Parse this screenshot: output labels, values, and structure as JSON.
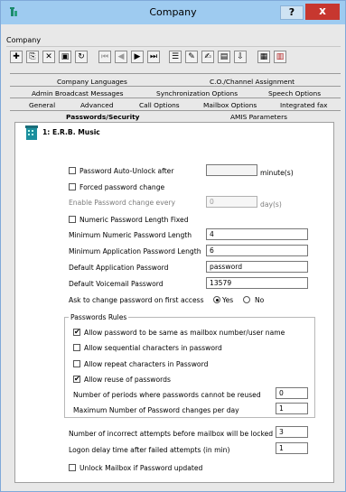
{
  "window": {
    "title": "Company",
    "help_label": "?",
    "close_label": "x"
  },
  "menu": {
    "items": [
      "Company"
    ]
  },
  "toolbar": {
    "icons": [
      "new-icon",
      "copy-icon",
      "delete-icon",
      "save-icon",
      "refresh-icon",
      "first-icon",
      "prev-icon",
      "next-icon",
      "last-icon",
      "list-icon",
      "edit-icon",
      "notes-icon",
      "report-icon",
      "import-icon",
      "report2-icon",
      "calendar-icon"
    ]
  },
  "tabs": {
    "row1": [
      "Company Languages",
      "C.O./Channel Assignment"
    ],
    "row2": [
      "Admin Broadcast Messages",
      "Synchronization Options",
      "Speech Options"
    ],
    "row3": [
      "General",
      "Advanced",
      "Call Options",
      "Mailbox Options",
      "Integrated fax"
    ],
    "row4": [
      "Passwords/Security",
      "AMIS Parameters"
    ]
  },
  "company": {
    "name": "1: E.R.B. Music"
  },
  "form": {
    "auto_unlock_label": "Password Auto-Unlock after",
    "auto_unlock_value": "",
    "auto_unlock_unit": "minute(s)",
    "forced_change_label": "Forced password change",
    "enable_change_label": "Enable Password change every",
    "enable_change_value": "0",
    "enable_change_unit": "day(s)",
    "numeric_fixed_label": "Numeric Password Length Fixed",
    "min_numeric_label": "Minimum Numeric Password Length",
    "min_numeric_value": "4",
    "min_app_label": "Minimum Application Password Length",
    "min_app_value": "6",
    "default_app_label": "Default Application Password",
    "default_app_value": "password",
    "default_vm_label": "Default Voicemail Password",
    "default_vm_value": "13579",
    "ask_change_label": "Ask to change password on first access",
    "yes_label": "Yes",
    "no_label": "No",
    "ask_change_selected": "Yes"
  },
  "rules": {
    "legend": "Passwords Rules",
    "same_as_mailbox_label": "Allow password to be same as mailbox number/user name",
    "same_as_mailbox_checked": true,
    "sequential_label": "Allow sequential characters in password",
    "sequential_checked": false,
    "repeat_label": "Allow repeat characters in Password",
    "repeat_checked": false,
    "reuse_label": "Allow reuse of passwords",
    "reuse_checked": true,
    "periods_label": "Number of periods where passwords cannot be reused",
    "periods_value": "0",
    "max_changes_label": "Maximum Number of Password changes per day",
    "max_changes_value": "1"
  },
  "lock": {
    "incorrect_label": "Number of incorrect attempts before mailbox will be  locked",
    "incorrect_value": "3",
    "delay_label": "Logon delay time after failed attempts (in min)",
    "delay_value": "1",
    "unlock_label": "Unlock Mailbox if Password updated"
  }
}
